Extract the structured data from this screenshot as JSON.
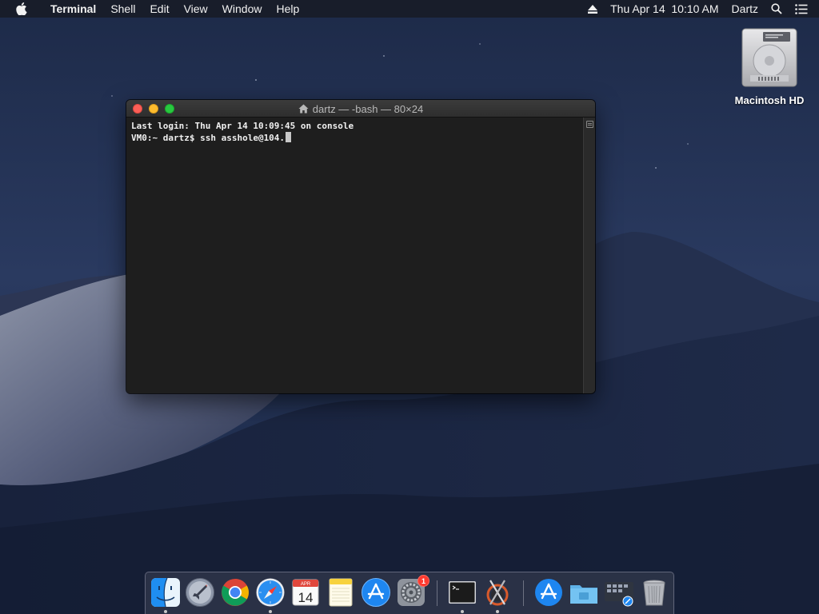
{
  "menubar": {
    "apple_icon": "apple-logo-icon",
    "app_name": "Terminal",
    "menus": [
      "Shell",
      "Edit",
      "View",
      "Window",
      "Help"
    ],
    "clock": "Thu Apr 14  10:10 AM",
    "user": "Dartz",
    "icons": [
      "eject-icon",
      "spotlight-search-icon",
      "notification-center-icon"
    ]
  },
  "desktop": {
    "hd_label": "Macintosh HD"
  },
  "terminal": {
    "title": "dartz — -bash — 80×24",
    "lines": [
      "Last login: Thu Apr 14 10:09:45 on console",
      "VM0:~ dartz$ ssh asshole@104."
    ]
  },
  "dock": {
    "items": [
      {
        "name": "Finder",
        "icon": "finder-icon",
        "running": true
      },
      {
        "name": "Launchpad",
        "icon": "launchpad-icon",
        "running": false
      },
      {
        "name": "Google Chrome",
        "icon": "chrome-icon",
        "running": false
      },
      {
        "name": "Safari",
        "icon": "safari-icon",
        "running": true
      },
      {
        "name": "Calendar",
        "icon": "calendar-icon",
        "running": false,
        "month": "APR",
        "day": "14"
      },
      {
        "name": "Notes",
        "icon": "notes-icon",
        "running": false
      },
      {
        "name": "App Store",
        "icon": "app-store-icon",
        "running": false
      },
      {
        "name": "System Preferences",
        "icon": "system-preferences-icon",
        "running": false,
        "badge": "1"
      },
      {
        "name": "Terminal",
        "icon": "terminal-icon",
        "running": true
      },
      {
        "name": "Xcode Instruments",
        "icon": "instruments-icon",
        "running": true
      },
      {
        "name": "Applications",
        "icon": "app-store-folder-icon",
        "running": false
      },
      {
        "name": "Documents",
        "icon": "folder-icon",
        "running": false
      },
      {
        "name": "Downloads",
        "icon": "downloads-stack-icon",
        "running": false
      },
      {
        "name": "Trash",
        "icon": "trash-icon",
        "running": false
      }
    ]
  }
}
